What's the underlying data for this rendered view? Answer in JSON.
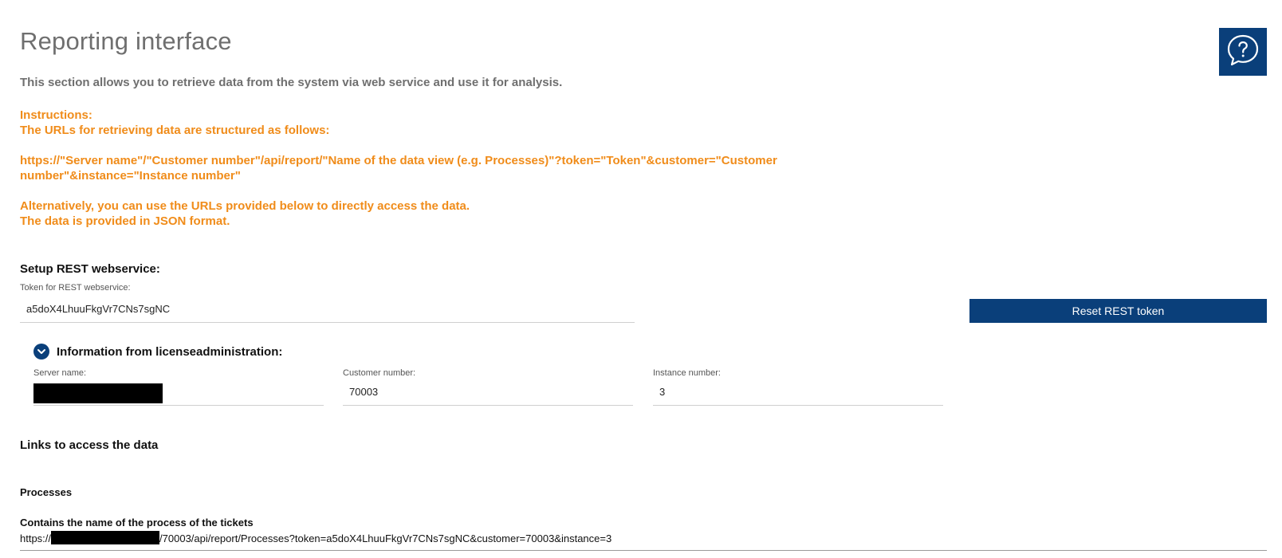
{
  "header": {
    "title": "Reporting interface",
    "help_icon": "help-chat-icon"
  },
  "intro": "This section allows you to retrieve data from the system via web service and use it for analysis.",
  "instructions": {
    "line1": "Instructions:",
    "line2": "The URLs for retrieving data are structured as follows:",
    "line3": "https://\"Server name\"/\"Customer number\"/api/report/\"Name of the data view (e.g. Processes)\"?token=\"Token\"&customer=\"Customer",
    "line4": "number\"&instance=\"Instance number\"",
    "line5": "Alternatively, you can use the URLs provided below to directly access the data.",
    "line6": "The data is provided in JSON format."
  },
  "rest": {
    "heading": "Setup REST webservice:",
    "token_label": "Token for REST webservice:",
    "token_value": "a5doX4LhuuFkgVr7CNs7sgNC",
    "reset_button": "Reset REST token"
  },
  "license": {
    "toggle_label": "Information from licenseadministration:",
    "toggle_icon": "chevron-down-icon",
    "server_label": "Server name:",
    "customer_label": "Customer number:",
    "customer_value": "70003",
    "instance_label": "Instance number:",
    "instance_value": "3"
  },
  "links": {
    "heading": "Links to access the data",
    "processes_heading": "Processes",
    "processes_desc": "Contains the name of the process of the tickets",
    "url_prefix": "https://",
    "url_suffix": "/70003/api/report/Processes?token=a5doX4LhuuFkgVr7CNs7sgNC&customer=70003&instance=3"
  },
  "colors": {
    "brand_blue": "#0a3f7a",
    "instruction_orange": "#f08c1a",
    "muted_gray": "#6f6f6f"
  }
}
